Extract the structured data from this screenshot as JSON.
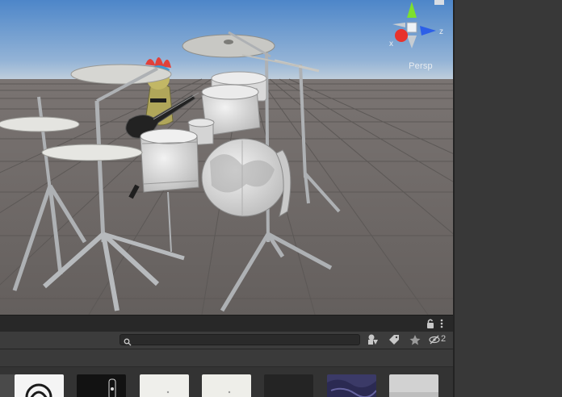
{
  "scene_view": {
    "camera_mode_label": "Persp",
    "gizmo": {
      "x_axis_label": "x",
      "z_axis_label": "z",
      "colors": {
        "x": "#e8322c",
        "y": "#7de02e",
        "z": "#2c5fe8"
      }
    },
    "colors": {
      "sky_top": "#4d86c9",
      "sky_horizon": "#b6c8da",
      "ground": "#6b6664",
      "grid": "#5e5a58",
      "drum": "#dedede",
      "stand": "#b7babd"
    }
  },
  "project_panel": {
    "toolbar": {
      "search_value": "",
      "search_icon": "search-icon",
      "filter_by_type_icon": "filter-type-icon",
      "filter_by_label_icon": "label-icon",
      "favorites_icon": "star-icon",
      "hidden_packages_count": "2"
    },
    "header_icons": [
      "lock-icon",
      "kebab-menu-icon"
    ],
    "assets": [
      {
        "kind": "emblem",
        "bg": "#f4f4f4"
      },
      {
        "kind": "dark-figure",
        "bg": "#121212"
      },
      {
        "kind": "light",
        "bg": "#efefeb"
      },
      {
        "kind": "light",
        "bg": "#eeeee9"
      },
      {
        "kind": "dark",
        "bg": "#242424"
      },
      {
        "kind": "texture",
        "bg": "#3b3a67"
      },
      {
        "kind": "grey",
        "bg": "#d2d2d2"
      }
    ]
  }
}
